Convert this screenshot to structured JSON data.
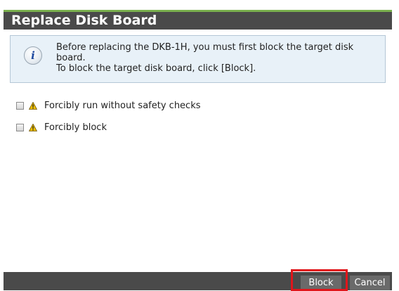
{
  "dialog": {
    "title": "Replace Disk Board",
    "info": {
      "icon": "info-icon",
      "line1": "Before replacing the DKB-1H, you must first block the target disk board.",
      "line2": "To block the target disk board, click [Block]."
    },
    "options": [
      {
        "label": "Forcibly run without safety checks",
        "checked": false,
        "icon": "warning-icon"
      },
      {
        "label": "Forcibly block",
        "checked": false,
        "icon": "warning-icon"
      }
    ],
    "buttons": {
      "block_label": "Block",
      "cancel_label": "Cancel"
    }
  },
  "colors": {
    "titlebar": "#4a4a4a",
    "titlebar_accent": "#7ab04e",
    "info_background": "#e8f1f8",
    "footer": "#4a4a4a",
    "highlight": "#e0161b"
  }
}
